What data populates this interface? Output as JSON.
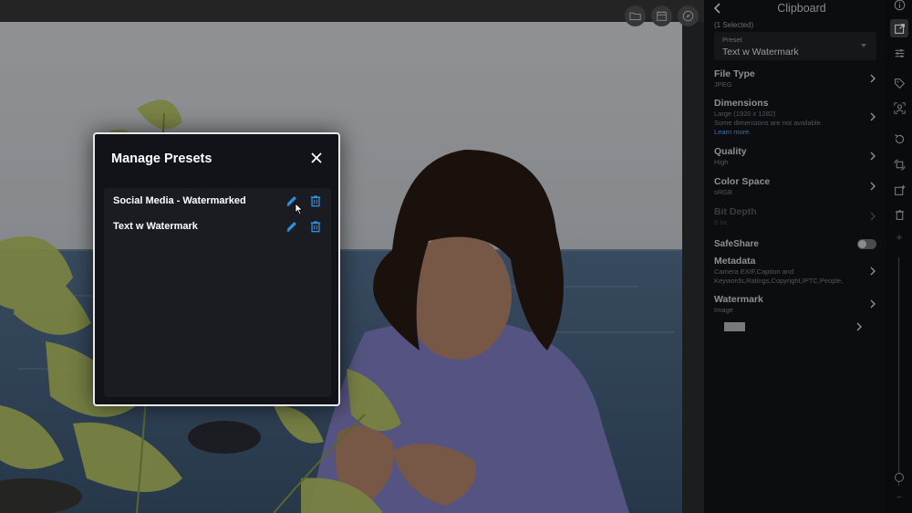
{
  "dialog": {
    "title": "Manage Presets",
    "presets": [
      {
        "name": "Social Media - Watermarked"
      },
      {
        "name": "Text w Watermark"
      }
    ]
  },
  "panel": {
    "title": "Clipboard",
    "selected": "(1 Selected)",
    "preset_label": "Preset",
    "preset_value": "Text w Watermark",
    "file_type": {
      "title": "File Type",
      "value": "JPEG"
    },
    "dimensions": {
      "title": "Dimensions",
      "value": "Large (1920 x 1282)",
      "note": "Some dimensions are not available.",
      "link": "Learn more."
    },
    "quality": {
      "title": "Quality",
      "value": "High"
    },
    "color_space": {
      "title": "Color Space",
      "value": "sRGB"
    },
    "bit_depth": {
      "title": "Bit Depth",
      "value": "8 bit"
    },
    "safeshare": {
      "title": "SafeShare",
      "enabled": false
    },
    "metadata": {
      "title": "Metadata",
      "value": "Camera EXIF,Caption and Keywords,Ratings,Copyright,IPTC,People,"
    },
    "watermark": {
      "title": "Watermark",
      "value": "Image"
    }
  },
  "icons": {
    "photo_tools": [
      "folder-icon",
      "calendar-icon",
      "compass-icon"
    ],
    "rail": [
      "info-icon",
      "export-icon",
      "adjustments-icon",
      "tag-icon",
      "people-icon",
      "rotate-icon",
      "transform-icon",
      "add-photo-icon",
      "trash-icon",
      "zoom-in-icon",
      "zoom-out-icon"
    ]
  },
  "colors": {
    "accent": "#2f8fe0",
    "dialog_bg": "#121319",
    "panel_bg": "#0c0d10"
  }
}
